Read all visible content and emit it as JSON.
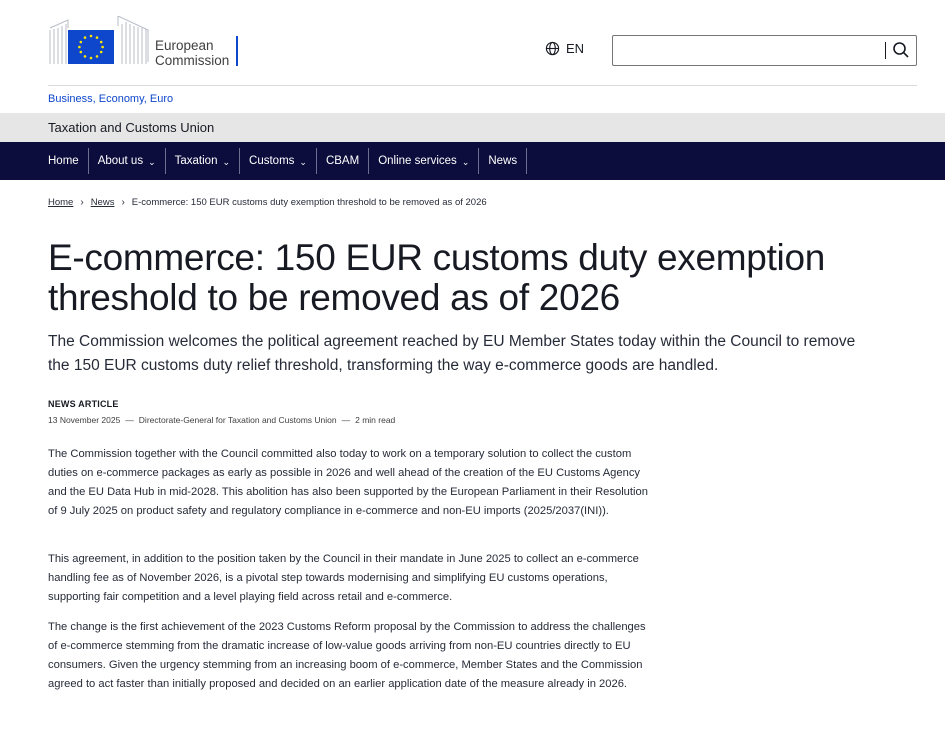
{
  "header": {
    "logo_line1": "European",
    "logo_line2": "Commission",
    "language": "EN",
    "search_value": "",
    "colors": {
      "brand_blue": "#0e47cb",
      "eu_flag_blue": "#0e47cb",
      "eu_star": "#ffe600",
      "nav_bg": "#0c0d3c"
    },
    "icons": {
      "language": "globe-icon",
      "search": "search-icon"
    }
  },
  "top_breadcrumb": "Business, Economy, Euro",
  "site_name": "Taxation and Customs Union",
  "nav": {
    "items": [
      {
        "label": "Home",
        "has_dropdown": false
      },
      {
        "label": "About us",
        "has_dropdown": true
      },
      {
        "label": "Taxation",
        "has_dropdown": true
      },
      {
        "label": "Customs",
        "has_dropdown": true
      },
      {
        "label": "CBAM",
        "has_dropdown": false
      },
      {
        "label": "Online services",
        "has_dropdown": true
      },
      {
        "label": "News",
        "has_dropdown": false
      }
    ]
  },
  "breadcrumb": {
    "home": "Home",
    "news": "News",
    "current": "E-commerce: 150 EUR customs duty exemption threshold to be removed as of 2026"
  },
  "article": {
    "title": "E-commerce: 150 EUR customs duty exemption threshold to be removed as of 2026",
    "lead": "The Commission welcomes the political agreement reached by EU Member States today within the Council to remove the 150 EUR customs duty relief threshold, transforming the way e-commerce goods are handled.",
    "type": "NEWS ARTICLE",
    "date": "13 November 2025",
    "author": "Directorate-General for Taxation and Customs Union",
    "read_time": "2 min read",
    "paragraphs": [
      "The Commission together with the Council committed also today to work on a temporary solution to collect the custom duties on e-commerce packages as early as possible in 2026 and well ahead of the creation of the EU Customs Agency and the EU Data Hub in mid-2028. This abolition has also been supported by the European Parliament in their Resolution of 9 July 2025 on product safety and regulatory compliance in e-commerce and non-EU imports (2025/2037(INI)).",
      "This agreement, in addition to the position taken by the Council in their mandate in June 2025 to collect an e-commerce handling fee as of November 2026, is a pivotal step towards modernising and simplifying EU customs operations, supporting fair competition and a level playing field across retail and e-commerce.",
      "The change is the first achievement of the 2023 Customs Reform proposal by the Commission to address the challenges of e-commerce stemming from the dramatic increase of low-value goods arriving from non-EU countries directly to EU consumers. Given the urgency stemming from an increasing boom of e-commerce, Member States and the Commission agreed to act faster than initially proposed and decided on an earlier application date of the measure already in 2026."
    ]
  }
}
